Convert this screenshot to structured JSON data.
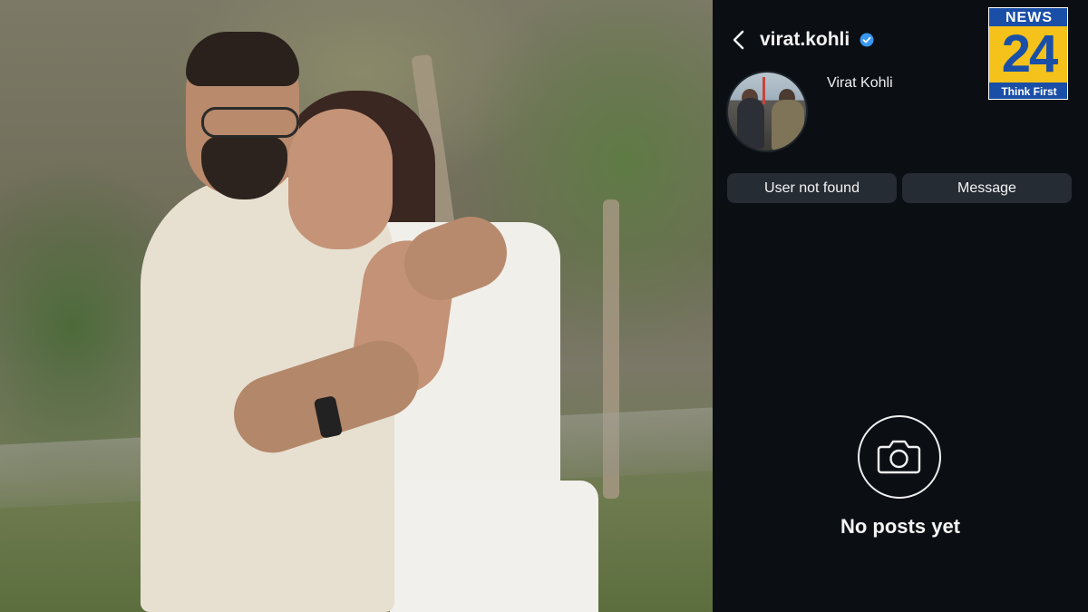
{
  "photo": {
    "description_icon": "couple-photo"
  },
  "profile": {
    "username": "virat.kohli",
    "verified": true,
    "full_name": "Virat Kohli",
    "status_button_label": "User not found",
    "message_button_label": "Message",
    "empty_state_text": "No posts yet",
    "empty_state_icon": "camera-icon"
  },
  "logo": {
    "top_text": "NEWS",
    "number": "24",
    "tagline": "Think First"
  },
  "colors": {
    "panel_bg": "#0b0f14",
    "button_bg": "#262c34",
    "verified_blue": "#3897f0",
    "logo_blue": "#1a4fa8",
    "logo_yellow": "#f4c21a"
  }
}
